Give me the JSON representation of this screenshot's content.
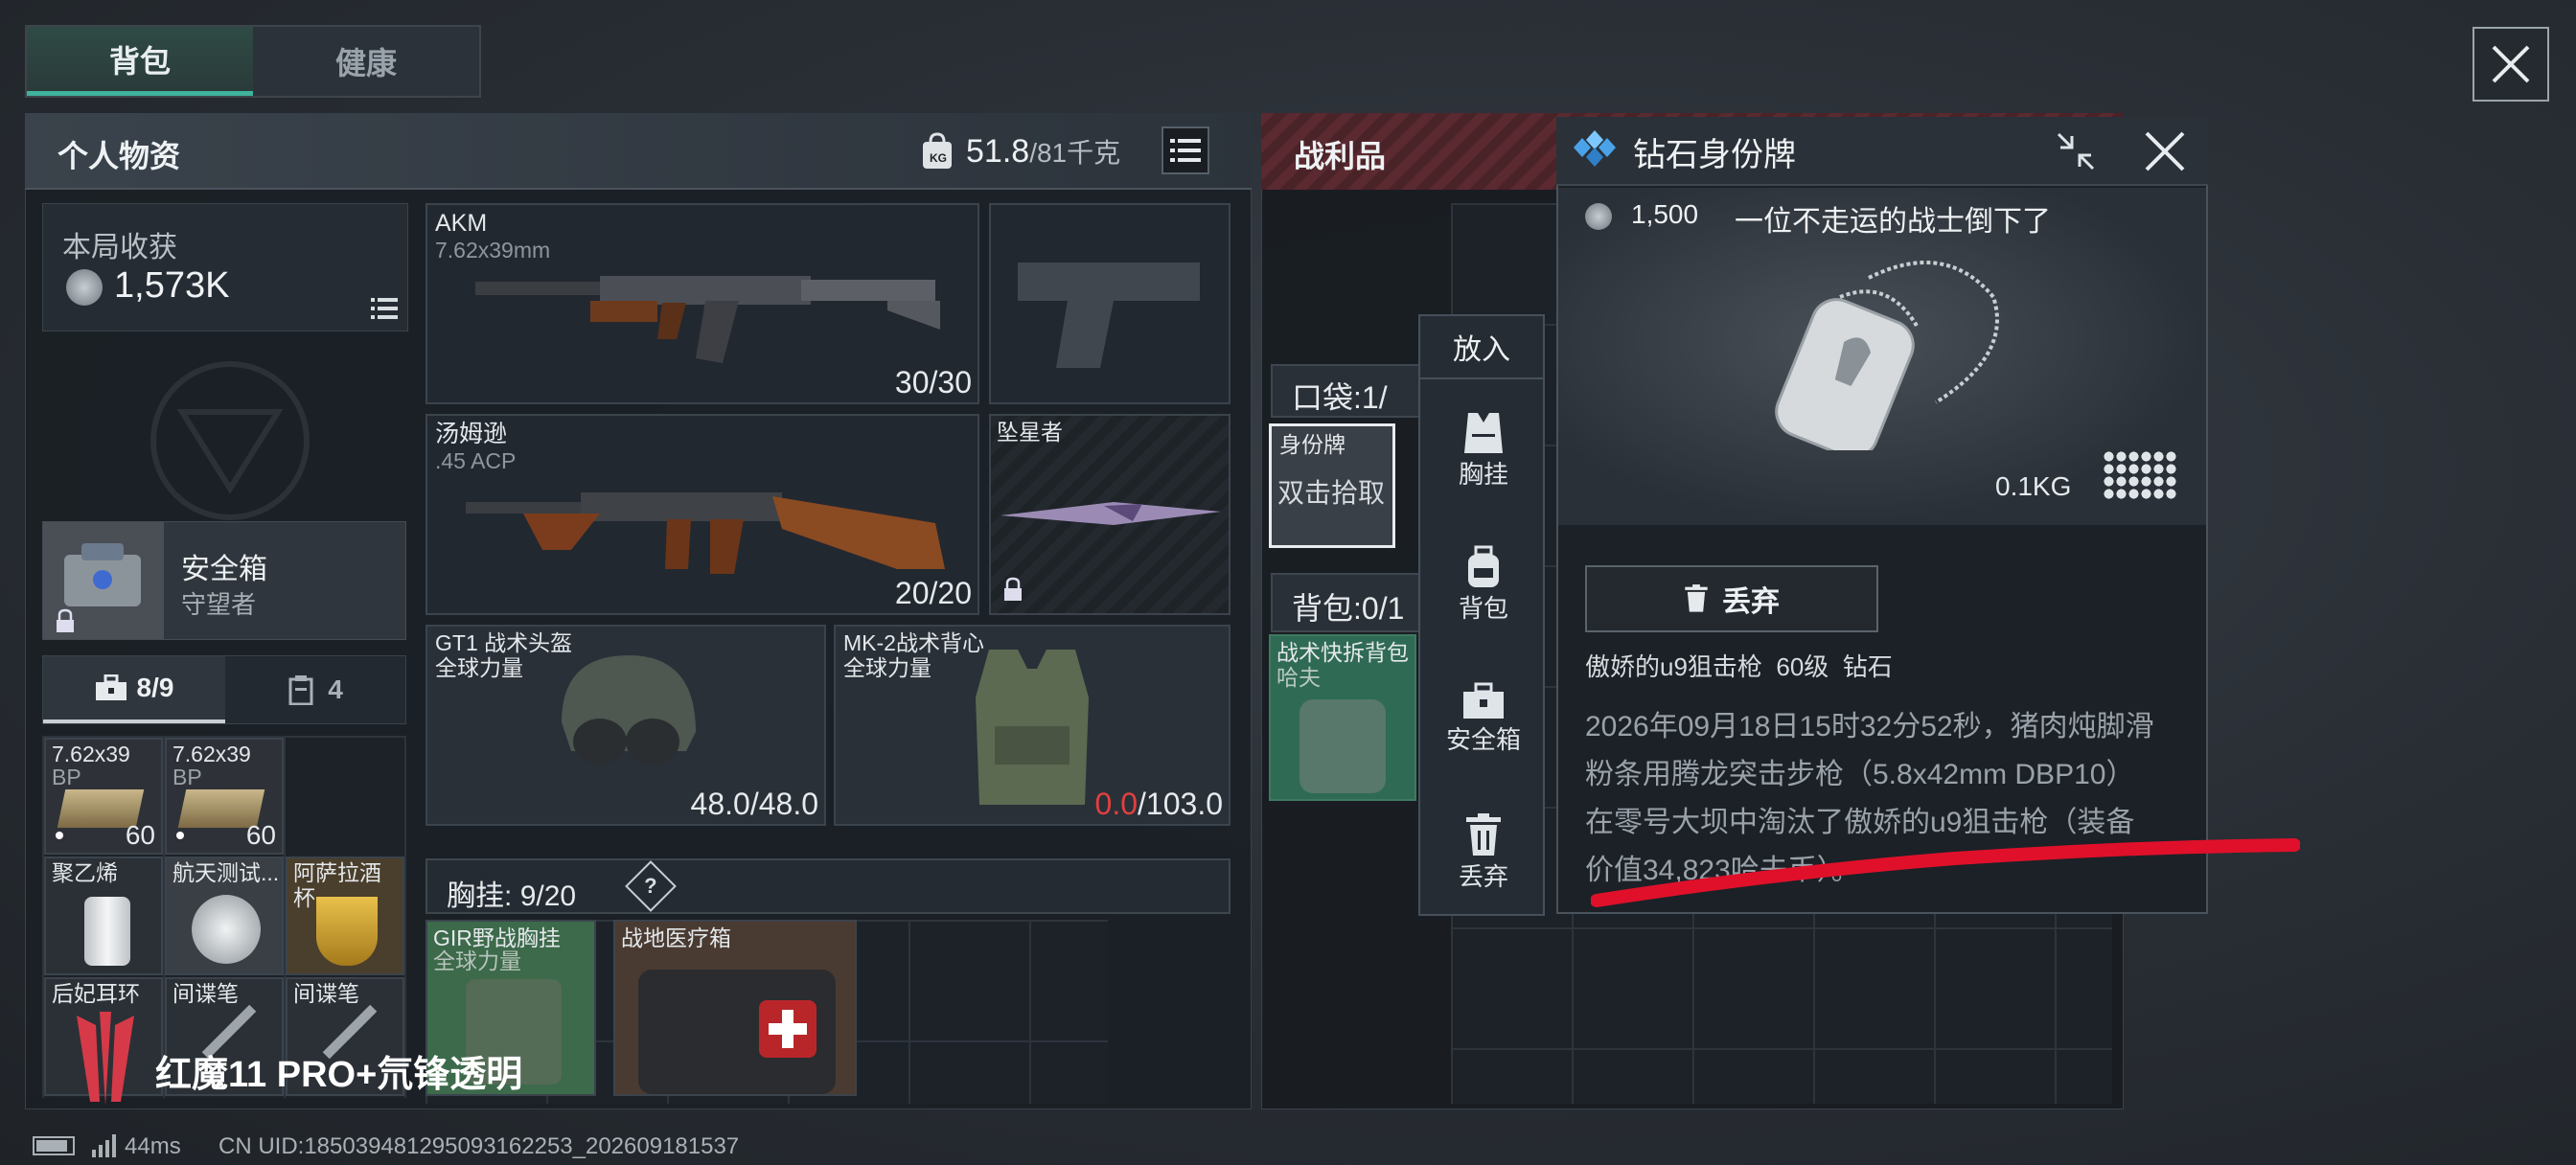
{
  "tabs": {
    "backpack": "背包",
    "health": "健康"
  },
  "personal": {
    "title": "个人物资",
    "weight_value": "51.8",
    "weight_max": "/81千克",
    "kg_icon_text": "KG",
    "earnings_label": "本局收获",
    "earnings_value": "1,573K"
  },
  "safebox": {
    "name": "安全箱",
    "sub": "守望者"
  },
  "sub_tabs": {
    "box_count": "8/9",
    "other_count": "4"
  },
  "ammo": [
    {
      "name": "7.62x39",
      "sub": "BP",
      "count": "60"
    },
    {
      "name": "7.62x39",
      "sub": "BP",
      "count": "60"
    }
  ],
  "small_items": [
    {
      "name": "聚乙烯"
    },
    {
      "name": "航天测试..."
    },
    {
      "name": "阿萨拉酒杯"
    },
    {
      "name": "后妃耳环"
    },
    {
      "name": "间谍笔"
    },
    {
      "name": "间谍笔"
    }
  ],
  "weapons": {
    "akm": {
      "name": "AKM",
      "caliber": "7.62x39mm",
      "ammo": "30/30"
    },
    "thompson": {
      "name": "汤姆逊",
      "caliber": ".45 ACP",
      "ammo": "20/20"
    },
    "knife": {
      "name": "坠星者"
    }
  },
  "helmet": {
    "name": "GT1 战术头盔",
    "maker": "全球力量",
    "durability": "48.0/48.0"
  },
  "armor": {
    "name": "MK-2战术背心",
    "maker": "全球力量",
    "durability_current": "0.0",
    "durability_max": "/103.0"
  },
  "chest_rig": {
    "label": "胸挂:",
    "count": "9/20",
    "help": "?"
  },
  "rig_items": [
    {
      "name": "GIR野战胸挂",
      "maker": "全球力量"
    },
    {
      "name": "战地医疗箱"
    }
  ],
  "loot": {
    "title": "战利品",
    "pocket_label": "口袋:",
    "pocket_count": "1/",
    "tag_slot_label": "身份牌",
    "tag_slot_action": "双击拾取",
    "backpack_label": "背包:",
    "backpack_count": "0/1",
    "loot_bag_name": "战术快拆背包",
    "loot_bag_maker": "哈夫"
  },
  "actions": {
    "header": "放入",
    "items": [
      {
        "label": "胸挂",
        "icon": "vest-icon"
      },
      {
        "label": "背包",
        "icon": "backpack-icon"
      },
      {
        "label": "安全箱",
        "icon": "toolbox-icon"
      },
      {
        "label": "丢弃",
        "icon": "trash-icon"
      }
    ]
  },
  "detail": {
    "title": "钻石身份牌",
    "price": "1,500",
    "flavor": "一位不走运的战士倒下了",
    "weight": "0.1KG",
    "discard_label": "丢弃",
    "owner_line": "傲娇的u9狙击枪  60级  钻石",
    "description": "2026年09月18日15时32分52秒，猪肉炖脚滑粉条用腾龙突击步枪（5.8x42mm DBP10）在零号大坝中淘汰了傲娇的u9狙击枪（装备价值34,823哈夫币）。"
  },
  "watermark": {
    "text": "红魔11 PRO+氘锋透明"
  },
  "status_bar": {
    "ping": "44ms",
    "uid": "CN UID:18503948129509316225​3_202609181537"
  },
  "colors": {
    "accent": "#3fb39c",
    "danger": "#e04040",
    "annotation": "#e0102a"
  }
}
